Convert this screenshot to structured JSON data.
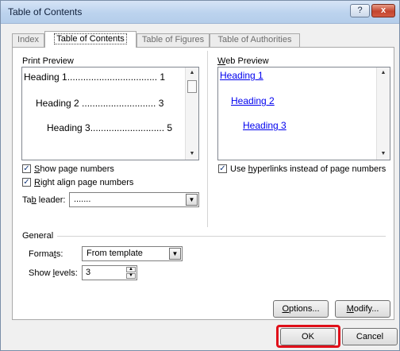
{
  "window": {
    "title": "Table of Contents",
    "help_label": "?",
    "close_label": "x"
  },
  "tabs": [
    {
      "label": "Index"
    },
    {
      "label": "Table of Contents",
      "active": true
    },
    {
      "label": "Table of Figures"
    },
    {
      "label": "Table of Authorities"
    }
  ],
  "print_preview": {
    "label": "Print Preview",
    "lines": [
      "Heading 1.................................. 1",
      "Heading 2 ............................ 3",
      "Heading 3............................ 5"
    ]
  },
  "web_preview": {
    "label": "Web Preview",
    "links": [
      "Heading 1",
      "Heading 2",
      "Heading 3"
    ]
  },
  "options": {
    "show_page_numbers": {
      "label": "Show page numbers",
      "checked": true
    },
    "right_align": {
      "label": "Right align page numbers",
      "checked": true
    },
    "use_hyperlinks": {
      "label": "Use hyperlinks instead of page numbers",
      "checked": true
    }
  },
  "tab_leader": {
    "label": "Tab leader:",
    "value": "......."
  },
  "general": {
    "label": "General",
    "formats_label": "Formats:",
    "formats_value": "From template",
    "levels_label": "Show levels:",
    "levels_value": "3"
  },
  "buttons": {
    "options": "Options...",
    "modify": "Modify...",
    "ok": "OK",
    "cancel": "Cancel"
  },
  "colors": {
    "highlight": "#e0101a",
    "link": "#0000ee"
  }
}
